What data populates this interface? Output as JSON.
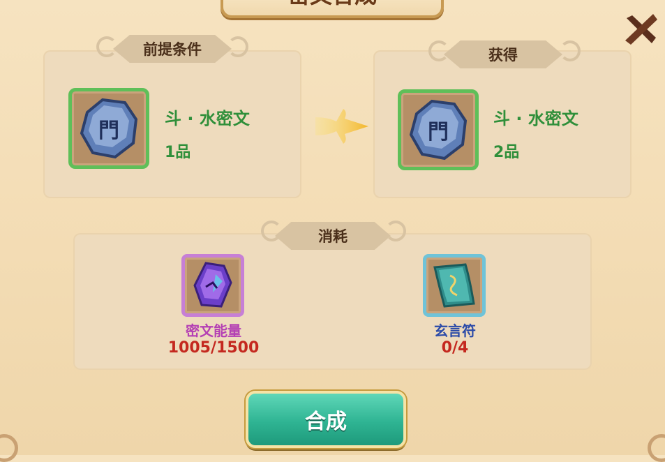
{
  "title": "密文合成",
  "prerequisite": {
    "label": "前提条件",
    "item_name": "斗 · 水密文",
    "grade": "1品",
    "icon": "rune-stone-icon"
  },
  "result": {
    "label": "获得",
    "item_name": "斗 · 水密文",
    "grade": "2品",
    "icon": "rune-stone-icon"
  },
  "consume": {
    "label": "消耗",
    "items": [
      {
        "name": "密文能量",
        "count": "1005/1500",
        "name_color": "#b43fb4",
        "icon": "energy-crystal-icon"
      },
      {
        "name": "玄言符",
        "count": "0/4",
        "name_color": "#2b4aa8",
        "icon": "talisman-scroll-icon"
      }
    ]
  },
  "craft_button": "合成",
  "colors": {
    "accent_green": "#2f8f3a",
    "count_red": "#c4281f",
    "button_teal": "#2fb493"
  }
}
